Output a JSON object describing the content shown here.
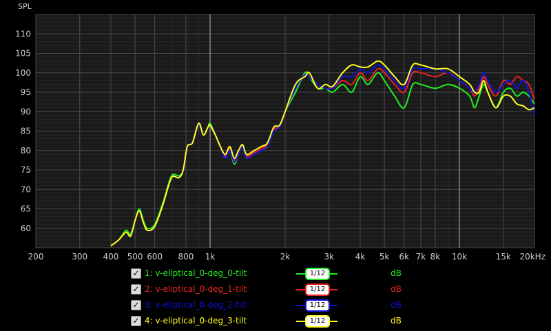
{
  "chart_data": {
    "type": "line",
    "ylabel": "SPL",
    "x_scale": "log",
    "xlim": [
      200,
      20000
    ],
    "ylim": [
      55,
      115
    ],
    "x_ticks": [
      {
        "v": 200,
        "t": "200",
        "major": false
      },
      {
        "v": 300,
        "t": "300",
        "major": false
      },
      {
        "v": 400,
        "t": "400",
        "major": false
      },
      {
        "v": 500,
        "t": "500",
        "major": false
      },
      {
        "v": 600,
        "t": "600",
        "major": false
      },
      {
        "v": 800,
        "t": "800",
        "major": false
      },
      {
        "v": 1000,
        "t": "1k",
        "major": true
      },
      {
        "v": 2000,
        "t": "2k",
        "major": false
      },
      {
        "v": 3000,
        "t": "3k",
        "major": false
      },
      {
        "v": 4000,
        "t": "4k",
        "major": false
      },
      {
        "v": 5000,
        "t": "5k",
        "major": false
      },
      {
        "v": 6000,
        "t": "6k",
        "major": false
      },
      {
        "v": 7000,
        "t": "7k",
        "major": false
      },
      {
        "v": 8000,
        "t": "8k",
        "major": false
      },
      {
        "v": 10000,
        "t": "10k",
        "major": true
      },
      {
        "v": 15000,
        "t": "15k",
        "major": false
      },
      {
        "v": 20000,
        "t": "20kHz",
        "major": false
      }
    ],
    "y_ticks": [
      60,
      65,
      70,
      75,
      80,
      85,
      90,
      95,
      100,
      105,
      110
    ],
    "grid": true,
    "series": [
      {
        "name": "1: v-eliptical_0-deg_0-tilt",
        "color": "#22ee22",
        "smoothing": "1/12",
        "unit": "dB",
        "points": [
          [
            400,
            55.5
          ],
          [
            430,
            57
          ],
          [
            460,
            59.5
          ],
          [
            480,
            58.5
          ],
          [
            500,
            62
          ],
          [
            520,
            65
          ],
          [
            540,
            62
          ],
          [
            560,
            60
          ],
          [
            600,
            61
          ],
          [
            650,
            67
          ],
          [
            700,
            73.5
          ],
          [
            750,
            73.5
          ],
          [
            780,
            75
          ],
          [
            810,
            81
          ],
          [
            850,
            82
          ],
          [
            900,
            87
          ],
          [
            940,
            84
          ],
          [
            980,
            86
          ],
          [
            1000,
            87
          ],
          [
            1050,
            84
          ],
          [
            1100,
            81
          ],
          [
            1150,
            78
          ],
          [
            1200,
            80
          ],
          [
            1250,
            76.5
          ],
          [
            1300,
            79
          ],
          [
            1350,
            81
          ],
          [
            1400,
            78
          ],
          [
            1500,
            79
          ],
          [
            1600,
            80
          ],
          [
            1700,
            81
          ],
          [
            1800,
            85
          ],
          [
            1900,
            86
          ],
          [
            2000,
            90
          ],
          [
            2200,
            95
          ],
          [
            2400,
            100
          ],
          [
            2500,
            99
          ],
          [
            2700,
            96
          ],
          [
            2900,
            96
          ],
          [
            3100,
            95
          ],
          [
            3400,
            97
          ],
          [
            3700,
            95
          ],
          [
            4000,
            99
          ],
          [
            4300,
            97
          ],
          [
            4700,
            100
          ],
          [
            5000,
            98
          ],
          [
            5500,
            94
          ],
          [
            6000,
            91
          ],
          [
            6500,
            97
          ],
          [
            7000,
            97
          ],
          [
            8000,
            96
          ],
          [
            9000,
            97
          ],
          [
            10000,
            96
          ],
          [
            11000,
            94
          ],
          [
            11500,
            91
          ],
          [
            12000,
            94
          ],
          [
            12500,
            97
          ],
          [
            13000,
            95
          ],
          [
            14000,
            91
          ],
          [
            15000,
            95
          ],
          [
            16000,
            96
          ],
          [
            17000,
            94
          ],
          [
            18000,
            95
          ],
          [
            19000,
            94
          ],
          [
            20000,
            92
          ]
        ]
      },
      {
        "name": "2: v-eliptical_0-deg_1-tilt",
        "color": "#ee2222",
        "smoothing": "1/12",
        "unit": "dB",
        "points": [
          [
            400,
            55.5
          ],
          [
            430,
            57
          ],
          [
            460,
            59
          ],
          [
            480,
            58
          ],
          [
            500,
            62
          ],
          [
            520,
            64.5
          ],
          [
            540,
            61.5
          ],
          [
            560,
            59.5
          ],
          [
            600,
            60.5
          ],
          [
            650,
            66.5
          ],
          [
            700,
            73
          ],
          [
            750,
            73
          ],
          [
            780,
            75
          ],
          [
            810,
            81
          ],
          [
            850,
            82
          ],
          [
            900,
            86.5
          ],
          [
            940,
            84
          ],
          [
            980,
            86
          ],
          [
            1000,
            86.5
          ],
          [
            1050,
            84
          ],
          [
            1100,
            81
          ],
          [
            1150,
            78.5
          ],
          [
            1200,
            80.5
          ],
          [
            1250,
            77.5
          ],
          [
            1300,
            79.5
          ],
          [
            1350,
            81
          ],
          [
            1400,
            78.5
          ],
          [
            1500,
            79.5
          ],
          [
            1600,
            80.5
          ],
          [
            1700,
            81.5
          ],
          [
            1800,
            85.5
          ],
          [
            1900,
            86
          ],
          [
            2000,
            90
          ],
          [
            2200,
            96
          ],
          [
            2400,
            99.5
          ],
          [
            2500,
            99
          ],
          [
            2700,
            97
          ],
          [
            2900,
            96
          ],
          [
            3100,
            96
          ],
          [
            3400,
            98
          ],
          [
            3700,
            97
          ],
          [
            4000,
            100
          ],
          [
            4300,
            98
          ],
          [
            4700,
            101
          ],
          [
            5000,
            100
          ],
          [
            5500,
            97
          ],
          [
            6000,
            95
          ],
          [
            6500,
            100
          ],
          [
            7000,
            100
          ],
          [
            8000,
            99
          ],
          [
            9000,
            100
          ],
          [
            10000,
            98
          ],
          [
            11000,
            96
          ],
          [
            11500,
            94
          ],
          [
            12000,
            96
          ],
          [
            12500,
            99
          ],
          [
            13000,
            97
          ],
          [
            14000,
            94
          ],
          [
            15000,
            98
          ],
          [
            16000,
            97
          ],
          [
            17000,
            99
          ],
          [
            18000,
            98
          ],
          [
            19000,
            97
          ],
          [
            20000,
            93
          ]
        ]
      },
      {
        "name": "3: v-eliptical_0-deg_2-tilt",
        "color": "#1111dd",
        "smoothing": "1/12",
        "unit": "dB",
        "points": [
          [
            400,
            55.5
          ],
          [
            430,
            57
          ],
          [
            460,
            59
          ],
          [
            480,
            58
          ],
          [
            500,
            62
          ],
          [
            520,
            64.5
          ],
          [
            540,
            61.5
          ],
          [
            560,
            59.5
          ],
          [
            600,
            60.5
          ],
          [
            650,
            66.5
          ],
          [
            700,
            73
          ],
          [
            750,
            73
          ],
          [
            780,
            75
          ],
          [
            810,
            81
          ],
          [
            850,
            82
          ],
          [
            900,
            86.5
          ],
          [
            940,
            84
          ],
          [
            980,
            86
          ],
          [
            1000,
            86.5
          ],
          [
            1050,
            84
          ],
          [
            1100,
            81
          ],
          [
            1150,
            78
          ],
          [
            1200,
            80
          ],
          [
            1250,
            77
          ],
          [
            1300,
            79
          ],
          [
            1350,
            81
          ],
          [
            1400,
            78
          ],
          [
            1500,
            79
          ],
          [
            1600,
            80
          ],
          [
            1700,
            81
          ],
          [
            1800,
            85
          ],
          [
            1900,
            86
          ],
          [
            2000,
            90
          ],
          [
            2200,
            96
          ],
          [
            2400,
            99.5
          ],
          [
            2500,
            99
          ],
          [
            2700,
            97
          ],
          [
            2900,
            96
          ],
          [
            3100,
            96
          ],
          [
            3400,
            99
          ],
          [
            3700,
            99
          ],
          [
            4000,
            101
          ],
          [
            4300,
            100
          ],
          [
            4700,
            102
          ],
          [
            5000,
            101
          ],
          [
            5500,
            98
          ],
          [
            6000,
            96
          ],
          [
            6500,
            101
          ],
          [
            7000,
            101
          ],
          [
            8000,
            101
          ],
          [
            9000,
            100
          ],
          [
            10000,
            98
          ],
          [
            11000,
            96
          ],
          [
            11500,
            95
          ],
          [
            12000,
            97
          ],
          [
            12500,
            100
          ],
          [
            13000,
            98
          ],
          [
            14000,
            95
          ],
          [
            15000,
            97
          ],
          [
            16000,
            98
          ],
          [
            17000,
            96
          ],
          [
            18000,
            98
          ],
          [
            19000,
            95
          ],
          [
            20000,
            89
          ]
        ]
      },
      {
        "name": "4: v-eliptical_0-deg_3-tilt",
        "color": "#ffff22",
        "smoothing": "1/12",
        "unit": "dB",
        "points": [
          [
            400,
            55.5
          ],
          [
            430,
            57
          ],
          [
            460,
            59
          ],
          [
            480,
            58
          ],
          [
            500,
            62
          ],
          [
            520,
            64.5
          ],
          [
            540,
            61.5
          ],
          [
            560,
            59.5
          ],
          [
            600,
            60.5
          ],
          [
            650,
            66.5
          ],
          [
            700,
            73
          ],
          [
            750,
            73
          ],
          [
            780,
            75
          ],
          [
            810,
            81
          ],
          [
            850,
            82
          ],
          [
            900,
            87
          ],
          [
            940,
            84
          ],
          [
            980,
            86
          ],
          [
            1000,
            86.5
          ],
          [
            1050,
            84
          ],
          [
            1100,
            81
          ],
          [
            1150,
            79
          ],
          [
            1200,
            81
          ],
          [
            1250,
            78
          ],
          [
            1300,
            80
          ],
          [
            1350,
            81.5
          ],
          [
            1400,
            79
          ],
          [
            1500,
            80
          ],
          [
            1600,
            81
          ],
          [
            1700,
            82
          ],
          [
            1800,
            86
          ],
          [
            1900,
            86.5
          ],
          [
            2000,
            90
          ],
          [
            2200,
            97
          ],
          [
            2400,
            99
          ],
          [
            2500,
            100
          ],
          [
            2700,
            96
          ],
          [
            2900,
            97
          ],
          [
            3100,
            96.5
          ],
          [
            3400,
            100
          ],
          [
            3700,
            102
          ],
          [
            4000,
            101.5
          ],
          [
            4300,
            101.5
          ],
          [
            4700,
            103
          ],
          [
            5000,
            102
          ],
          [
            5500,
            99
          ],
          [
            6000,
            97
          ],
          [
            6500,
            102
          ],
          [
            7000,
            102
          ],
          [
            8000,
            101
          ],
          [
            9000,
            101
          ],
          [
            10000,
            99
          ],
          [
            11000,
            97
          ],
          [
            11500,
            95
          ],
          [
            12000,
            95
          ],
          [
            12500,
            98
          ],
          [
            13000,
            95
          ],
          [
            14000,
            91
          ],
          [
            15000,
            94
          ],
          [
            16000,
            94
          ],
          [
            17000,
            92
          ],
          [
            18000,
            91.5
          ],
          [
            19000,
            90.5
          ],
          [
            20000,
            91
          ]
        ]
      }
    ]
  }
}
